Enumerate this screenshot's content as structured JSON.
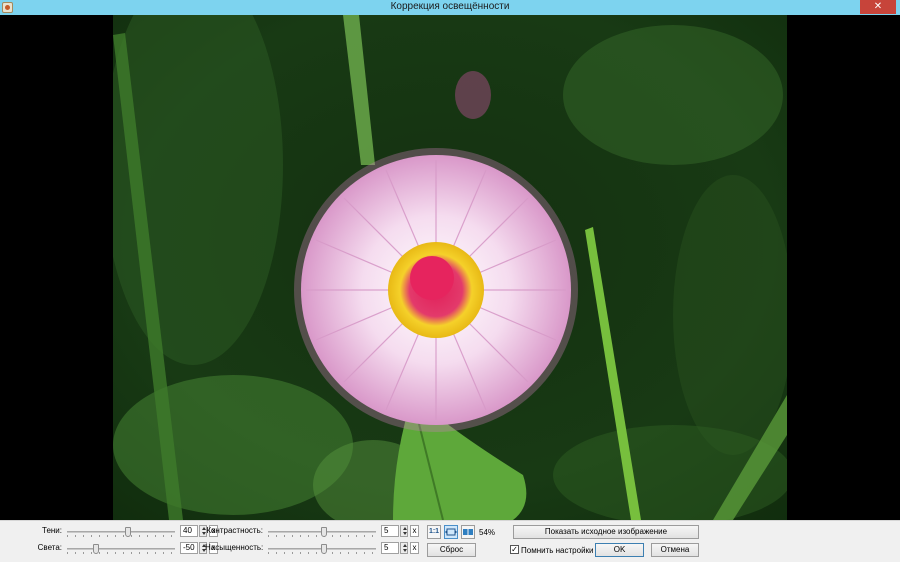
{
  "window": {
    "title": "Коррекция освещённости",
    "close_label": "✕"
  },
  "controls": {
    "shadows": {
      "label": "Тени:",
      "value": "40",
      "reset": "x",
      "position": 0.57
    },
    "highlights": {
      "label": "Света:",
      "value": "-50",
      "reset": "x",
      "position": 0.25
    },
    "contrast": {
      "label": "Контрастность:",
      "value": "5",
      "reset": "x",
      "position": 0.52
    },
    "saturation": {
      "label": "Насыщенность:",
      "value": "5",
      "reset": "x",
      "position": 0.52
    }
  },
  "view": {
    "actual_size_label": "1:1",
    "zoom": "54%",
    "show_original_label": "Показать исходное изображение",
    "reset_label": "Сброс",
    "remember_label": "Помнить настройки",
    "remember_checked": true,
    "ok_label": "OK",
    "cancel_label": "Отмена"
  }
}
